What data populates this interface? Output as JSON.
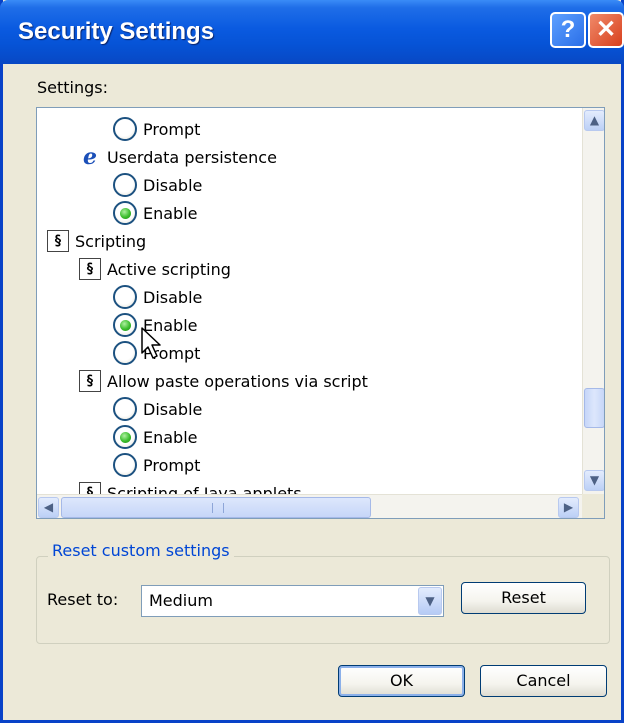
{
  "window": {
    "title": "Security Settings",
    "help_glyph": "?",
    "close_glyph": "✕"
  },
  "settings_label": "Settings:",
  "tree": [
    {
      "type": "radio",
      "label": "Prompt",
      "checked": false
    },
    {
      "type": "header",
      "icon": "ie-icon",
      "label": "Userdata persistence"
    },
    {
      "type": "radio",
      "label": "Disable",
      "checked": false
    },
    {
      "type": "radio",
      "label": "Enable",
      "checked": true
    },
    {
      "type": "header",
      "icon": "script-icon",
      "label": "Scripting"
    },
    {
      "type": "header",
      "icon": "script-icon",
      "label": "Active scripting"
    },
    {
      "type": "radio",
      "label": "Disable",
      "checked": false
    },
    {
      "type": "radio",
      "label": "Enable",
      "checked": true
    },
    {
      "type": "radio",
      "label": "Prompt",
      "checked": false
    },
    {
      "type": "header",
      "icon": "script-icon",
      "label": "Allow paste operations via script"
    },
    {
      "type": "radio",
      "label": "Disable",
      "checked": false
    },
    {
      "type": "radio",
      "label": "Enable",
      "checked": true
    },
    {
      "type": "radio",
      "label": "Prompt",
      "checked": false
    },
    {
      "type": "header",
      "icon": "script-icon",
      "label": "Scripting of Java applets"
    }
  ],
  "reset_group": {
    "title": "Reset custom settings",
    "reset_to_label": "Reset to:",
    "selected": "Medium",
    "reset_button": "Reset"
  },
  "ok_button": "OK",
  "cancel_button": "Cancel",
  "colors": {
    "titlebar": "#0a5ae0",
    "accent": "#0046d5",
    "radio_checked": "#3bbd2d"
  }
}
